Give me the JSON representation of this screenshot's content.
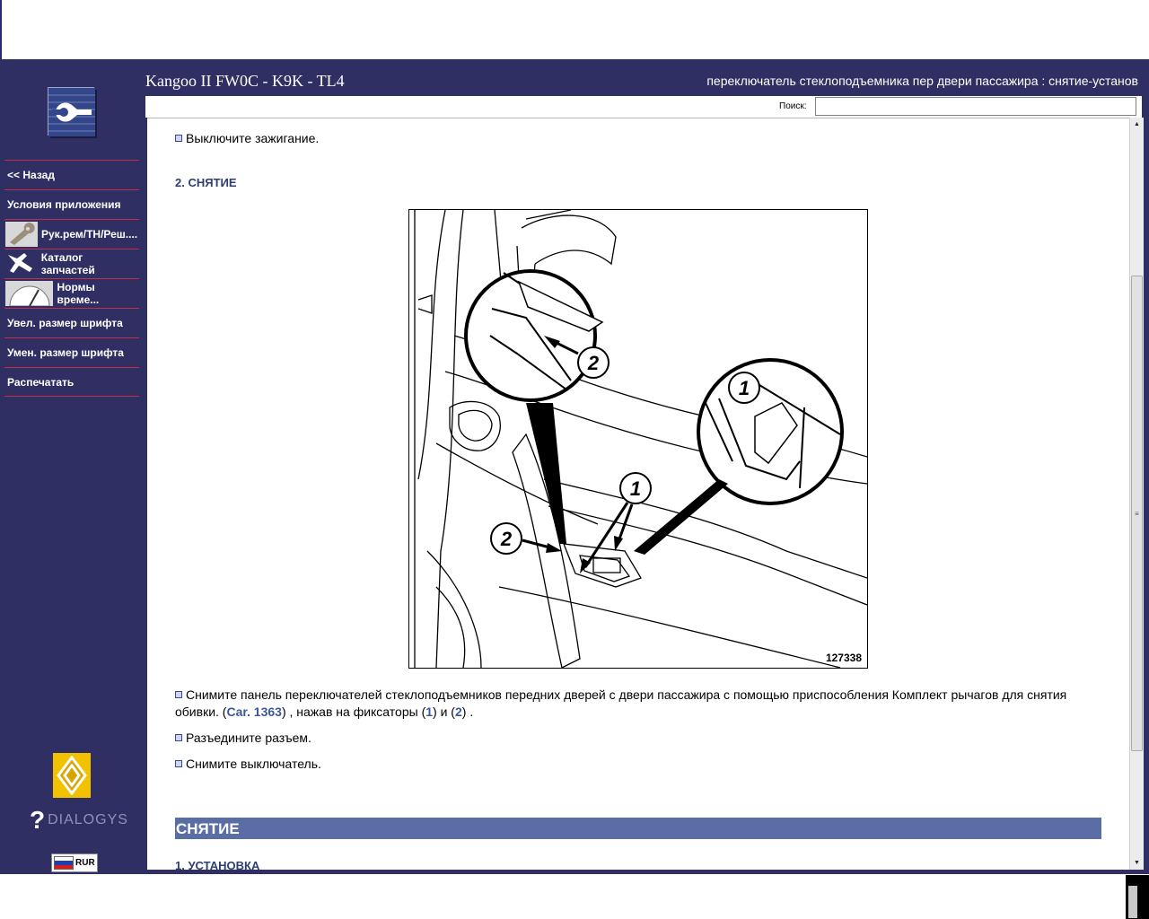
{
  "header": {
    "title": "Kangoo II FW0C - K9K - TL4",
    "subtitle": "переключатель стеклоподъемника пер двери пассажира : снятие-установ"
  },
  "search": {
    "label": "Поиск:",
    "value": ""
  },
  "sidebar": {
    "items": [
      {
        "label": "<< Назад",
        "icon": ""
      },
      {
        "label": "Условия приложения",
        "icon": ""
      },
      {
        "label": "Рук.рем/ТН/Реш....",
        "icon": "wrench-icon"
      },
      {
        "label": "Каталог запчастей",
        "icon": "parts-icon"
      },
      {
        "label": "Нормы време...",
        "icon": "gauge-icon"
      },
      {
        "label": "Увел. размер шрифта",
        "icon": ""
      },
      {
        "label": "Умен. размер шрифта",
        "icon": ""
      },
      {
        "label": "Распечатать",
        "icon": ""
      }
    ],
    "brand": "DIALOGYS",
    "language": "RUR"
  },
  "content": {
    "bullet_top": "Выключите зажигание.",
    "section_removal": "2. СНЯТИЕ",
    "figure_number": "127338",
    "figure_callouts": [
      "1",
      "2",
      "1",
      "2"
    ],
    "step1": {
      "line1": "Снимите панель переключателей стеклоподъемников передних дверей с двери пассажира с помощью приспособления Комплект рычагов для снятия",
      "line2_prefix": "обивки. (",
      "tool_link": "Car. 1363",
      "middle": ") , нажав на фиксаторы (",
      "ref1": "1",
      "and": ") и (",
      "ref2": "2",
      "end": ") ."
    },
    "step2": "Разъедините разъем.",
    "step3": "Снимите выключатель.",
    "bar_heading": "СНЯТИЕ",
    "section_install": "1. УСТАНОВКА"
  },
  "colors": {
    "frame": "#2f2f64",
    "menu_divider": "#c0304a",
    "heading_bar": "#5a6ea5",
    "heading_text": "#2d3f72"
  }
}
